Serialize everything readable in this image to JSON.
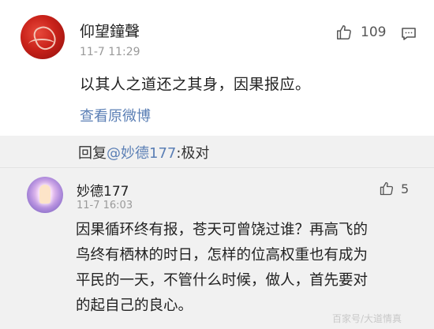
{
  "comments": [
    {
      "username": "仰望鐘聲",
      "timestamp": "11-7 11:29",
      "likes": "109",
      "text": "以其人之道还之其身，因果报应。",
      "view_original": "查看原微博"
    },
    {
      "username": "妙德177",
      "timestamp": "11-7 16:03",
      "likes": "5",
      "text_lines": [
        "因果循环终有报，苍天可曾饶过谁？再高飞的",
        "鸟终有栖林的时日，怎样的位高权重也有成为",
        "平民的一天，不管什么时候，做人，首先要对",
        "的起自己的良心。"
      ]
    }
  ],
  "reply": {
    "prefix": "回复",
    "mention": "@妙德177",
    "suffix": ":极对"
  },
  "icons": {
    "like": "thumbs-up-icon",
    "comment": "comment-icon"
  },
  "colors": {
    "link": "#5b7fb5",
    "timestamp": "#9a9a9a"
  },
  "watermark": "百家号/大道情真"
}
